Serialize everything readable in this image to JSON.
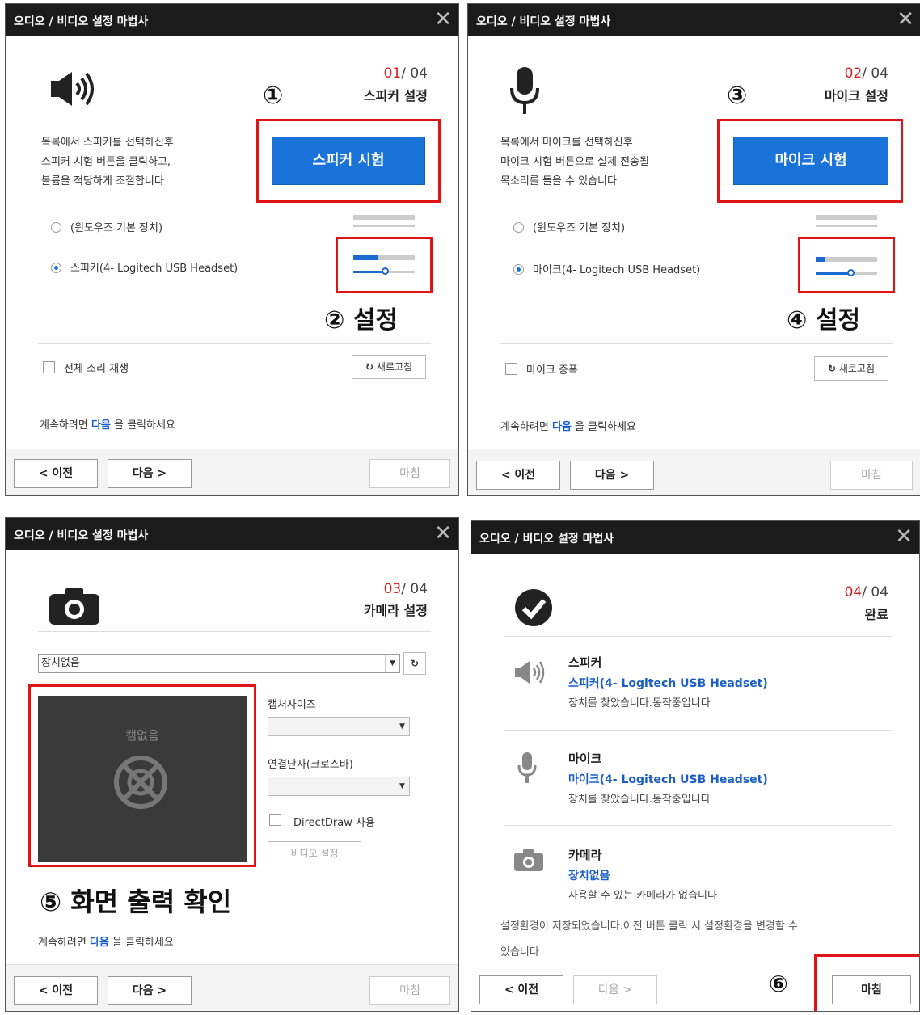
{
  "title": "오디오 / 비디오 설정 마법사",
  "close_symbol": "✕",
  "total_steps": "/ 04",
  "nav": {
    "prev": "< 이전",
    "next": "다음 >",
    "finish": "마침"
  },
  "continue_text": {
    "before": "계속하려면 ",
    "next": "다음",
    "after": " 을 클릭하세요"
  },
  "refresh_label": "새로고침",
  "panel1": {
    "step": "01",
    "step_title": "스피커 설정",
    "desc": [
      "목록에서 스피커를 선택하신후",
      "스피커 시험 버튼을 클릭하고,",
      "볼륨을 적당하게 조절합니다"
    ],
    "test_button": "스피커 시험",
    "devices": [
      "(윈도우즈 기본 장치)",
      "스피커(4- Logitech USB Headset)"
    ],
    "selected_device": 1,
    "checkbox": "전체 소리 재생",
    "annot_test": "①",
    "annot_set": "② 설정"
  },
  "panel2": {
    "step": "02",
    "step_title": "마이크 설정",
    "desc": [
      "목록에서 마이크를 선택하신후",
      "마이크 시험 버튼으로 실제 전송될",
      "목소리를 들을 수 있습니다"
    ],
    "test_button": "마이크 시험",
    "devices": [
      "(윈도우즈 기본 장치)",
      "마이크(4- Logitech USB Headset)"
    ],
    "selected_device": 1,
    "checkbox": "마이크 증폭",
    "annot_test": "③",
    "annot_set": "④ 설정"
  },
  "panel3": {
    "step": "03",
    "step_title": "카메라 설정",
    "device_select": "장치없음",
    "no_cam": "캠없음",
    "capture_size_label": "캡처사이즈",
    "connector_label": "연결단자(크로스바)",
    "directdraw_label": "DirectDraw 사용",
    "video_settings": "비디오 설정",
    "annot": "⑤ 화면 출력 확인"
  },
  "panel4": {
    "step": "04",
    "step_title": "완료",
    "items": [
      {
        "title": "스피커",
        "device": "스피커(4- Logitech USB Headset)",
        "status": "장치를 찾았습니다.동작중입니다",
        "icon": "speaker-icon"
      },
      {
        "title": "마이크",
        "device": "마이크(4- Logitech USB Headset)",
        "status": "장치를 찾았습니다.동작중입니다",
        "icon": "microphone-icon"
      },
      {
        "title": "카메라",
        "device": "장치없음",
        "status": "사용할 수 있는 카메라가 없습니다",
        "icon": "camera-icon"
      }
    ],
    "saved_note_1": "설정환경이 저장되었습니다.이전 버튼 클릭 시 설정환경을 변경할 수",
    "saved_note_2": "있습니다",
    "annot": "⑥"
  },
  "colors": {
    "accent": "#1a73d8",
    "annotation": "#e01414",
    "titlebar": "#1b1b1b",
    "step": "#d12020"
  }
}
